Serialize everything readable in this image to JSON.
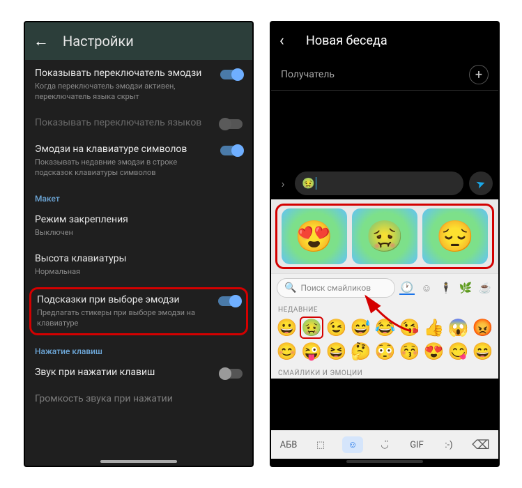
{
  "left": {
    "title": "Настройки",
    "settings": [
      {
        "title": "Показывать переключатель эмодзи",
        "desc": "Когда переключатель эмодзи активен, переключатель языка скрыт",
        "on": true
      },
      {
        "title": "Показывать переключатель языков",
        "desc": "",
        "on": false,
        "disabled": true
      },
      {
        "title": "Эмодзи на клавиатуре символов",
        "desc": "Показывать недавние эмодзи в строке подсказок клавиатуры символов",
        "on": true
      }
    ],
    "section_layout": "Макет",
    "pin_mode": {
      "title": "Режим закрепления",
      "desc": "Выключен"
    },
    "kb_height": {
      "title": "Высота клавиатуры",
      "desc": "Нормальная"
    },
    "emoji_hints": {
      "title": "Подсказки при выборе эмодзи",
      "desc": "Предлагать стикеры при выборе эмодзи на клавиатуре",
      "on": true
    },
    "section_keys": "Нажатие клавиш",
    "sound": {
      "title": "Звук при нажатии клавиш",
      "on": false
    },
    "volume": {
      "title": "Громкость звука при нажатии"
    }
  },
  "right": {
    "title": "Новая беседа",
    "recipient": "Получатель",
    "compose_emoji": "🤢",
    "search_placeholder": "Поиск смайликов",
    "recent_label": "НЕДАВНИЕ",
    "emotions_label": "СМАЙЛИКИ И ЭМОЦИИ",
    "abc": "АБВ",
    "gif": "GIF",
    "emoji_rows": [
      [
        "😀",
        "🤢",
        "😉",
        "😅",
        "😂",
        "😘",
        "👍",
        "😱",
        "😡"
      ],
      [
        "😊",
        "😜",
        "😆",
        "🤔",
        "😳",
        "😚",
        "😍",
        "😋",
        "😄"
      ]
    ],
    "bottom_icons": [
      ":-)"
    ]
  }
}
